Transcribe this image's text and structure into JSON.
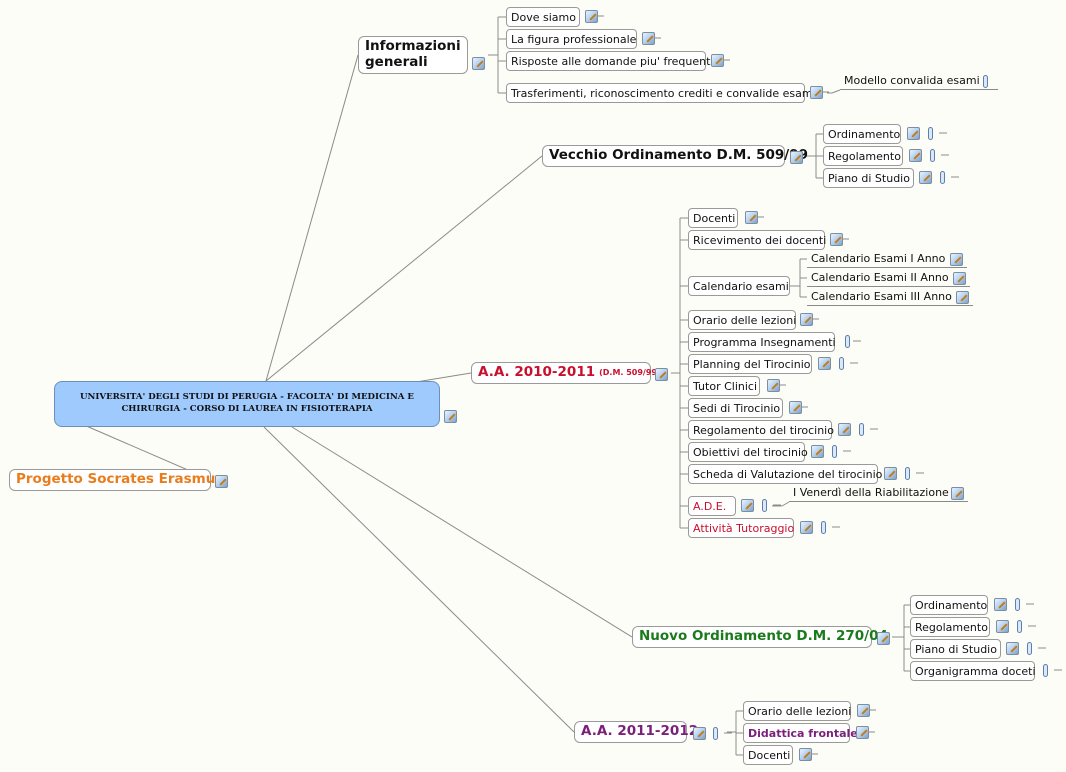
{
  "colors": {
    "background": "#fdfdf7",
    "connector": "#8a8a8a",
    "root_fill": "#9fcafe",
    "orange": "#e87d1e",
    "red": "#c8102e",
    "green": "#1b7a1b",
    "purple": "#7a1f7a",
    "black": "#111111"
  },
  "icons": {
    "note": "note-icon",
    "attachment": "paperclip-icon"
  },
  "root": {
    "label": "UNIVERSITA' DEGLI STUDI DI PERUGIA  - FACOLTA' DI MEDICINA E CHIRURGIA  -  CORSO DI LAUREA IN FISIOTERAPIA"
  },
  "branches": {
    "info": {
      "label": "Informazioni generali",
      "children": {
        "dove": "Dove siamo",
        "figura": "La figura professionale",
        "faq": "Risposte alle domande piu' frequenti",
        "trasferimenti": "Trasferimenti, riconoscimento crediti e convalide esami",
        "modello": "Modello convalida esami"
      }
    },
    "vecchio": {
      "label": "Vecchio Ordinamento D.M. 509/99",
      "children": {
        "ordinamento": "Ordinamento",
        "regolamento": "Regolamento",
        "piano": "Piano di Studio"
      }
    },
    "aa2010": {
      "label": "A.A. 2010-2011",
      "sublabel": "(D.M. 509/99)",
      "children": {
        "docenti": "Docenti",
        "ricevimento": "Ricevimento dei docenti",
        "calendario": "Calendario esami",
        "cal1": "Calendario Esami I Anno",
        "cal2": "Calendario Esami II Anno",
        "cal3": "Calendario Esami III Anno",
        "orario": "Orario delle lezioni",
        "programma": "Programma Insegnamenti",
        "planning": "Planning del Tirocinio",
        "tutor": "Tutor Clinici",
        "sedi": "Sedi di Tirocinio",
        "regtir": "Regolamento del tirocinio",
        "obiettivi": "Obiettivi del tirocinio",
        "scheda": "Scheda di Valutazione del tirocinio",
        "ade": "A.D.E.",
        "venerdi": "I Venerdì della Riabilitazione",
        "tutoraggio": "Attività Tutoraggio"
      }
    },
    "socrates": {
      "label": "Progetto Socrates Erasmus"
    },
    "nuovo": {
      "label": "Nuovo Ordinamento D.M. 270/04",
      "children": {
        "ordinamento": "Ordinamento",
        "regolamento": "Regolamento",
        "piano": "Piano di Studio",
        "organigramma": "Organigramma doceti"
      }
    },
    "aa2011": {
      "label": "A.A. 2011-2012",
      "children": {
        "orario": "Orario delle lezioni",
        "didattica": "Didattica frontale",
        "docenti": "Docenti"
      }
    }
  }
}
